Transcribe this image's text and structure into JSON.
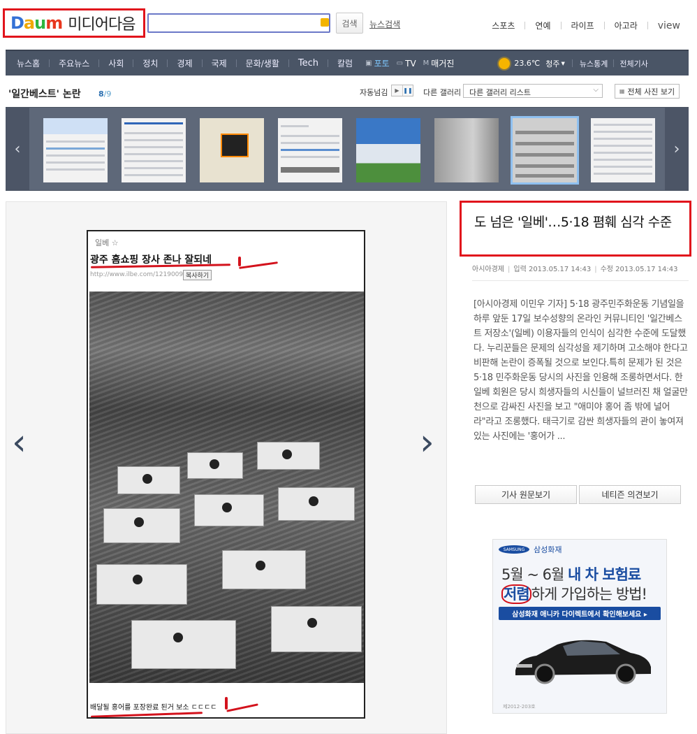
{
  "header": {
    "logo_letters": [
      "D",
      "a",
      "u",
      "m"
    ],
    "brand": "미디어다음",
    "search_placeholder": "",
    "search_button": "검색",
    "news_search": "뉴스검색",
    "top_links": [
      "스포츠",
      "연예",
      "라이프",
      "아고라",
      "view"
    ]
  },
  "nav": {
    "items": [
      "뉴스홈",
      "주요뉴스",
      "사회",
      "정치",
      "경제",
      "국제",
      "문화/생활",
      "Tech",
      "칼럼"
    ],
    "media": [
      {
        "icon": "▣",
        "label": "포토",
        "active": true
      },
      {
        "icon": "▭",
        "label": "TV",
        "active": false
      },
      {
        "icon": "M",
        "label": "매거진",
        "active": false
      }
    ],
    "weather_temp": "23.6℃",
    "weather_city": "청주",
    "right_links": [
      "뉴스통계",
      "전체기사"
    ]
  },
  "gallery": {
    "title": "'일간베스트' 논란",
    "current": "8",
    "total": "/9",
    "autoplay_label": "자동넘김",
    "other_label": "다른 갤러리",
    "select_value": "다른 갤러리 리스트",
    "all_photos": "전체 사진 보기",
    "thumbnails_count": 8,
    "active_thumbnail": 7
  },
  "photo": {
    "ilbe_label": "일베 ☆",
    "headline": "광주 홈쇼핑 장사 존나 잘되네",
    "url": "http://www.ilbe.com/1219009969",
    "copy_btn": "복사하기",
    "caption": "배달될 홍어를 포장완료 된거 보소 ㄷㄷㄷㄷ"
  },
  "article": {
    "title": "도 넘은 '일베'…5·18 폄훼 심각 수준",
    "source": "아시아경제",
    "published": "입력 2013.05.17 14:43",
    "modified": "수정 2013.05.17 14:43",
    "body": "[아시아경제 이민우 기자] 5·18 광주민주화운동 기념일을 하루 앞둔 17일 보수성향의 온라인 커뮤니티인 '일간베스트 저장소'(일베) 이용자들의 인식이 심각한 수준에 도달했다. 누리꾼들은 문제의 심각성을 제기하며 고소해야 한다고 비판해 논란이 증폭될 것으로 보인다.특히 문제가 된 것은 5·18 민주화운동 당시의 사진을 인용해 조롱하면서다. 한 일베 회원은 당시 희생자들의 시신들이 널브러진 채 얼굴만 천으로 감싸진 사진을 보고 \"애미야 홍어 좀 밖에 널어라\"라고 조롱했다. 태극기로 감싼 희생자들의 관이 놓여져 있는 사진에는 '홍어가 ...",
    "btn_original": "기사 원문보기",
    "btn_comments": "네티즌 의견보기"
  },
  "ad": {
    "logo": "SAMSUNG",
    "brand": "삼성화재",
    "line1_plain": "5월 ~ 6월 ",
    "line1_bold": "내 차 보험료",
    "line2_bold": "저렴",
    "line2_plain": "하게 가입하는 방법!",
    "cta": "삼성화재 애니카 다이렉트에서 확인해보세요 ▸",
    "fine_print": "제2012-203호"
  }
}
